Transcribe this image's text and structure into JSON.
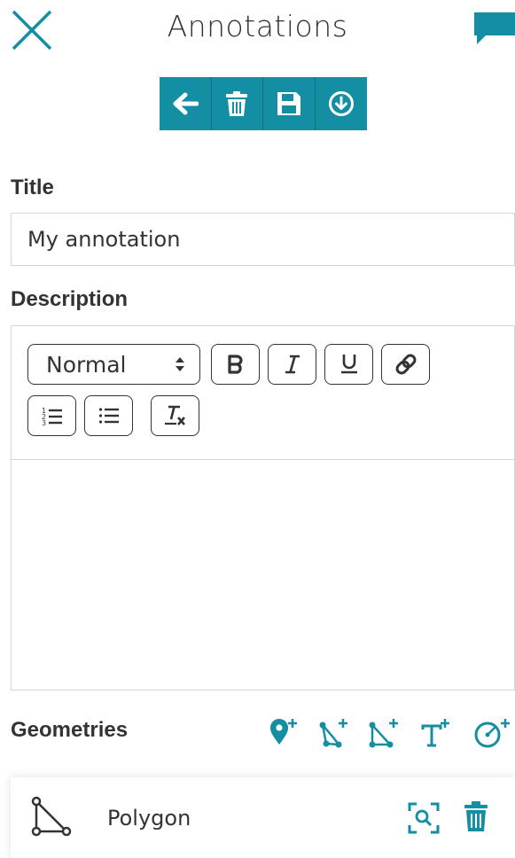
{
  "header": {
    "title": "Annotations"
  },
  "toolbar": {
    "buttons": [
      "back-arrow-icon",
      "trash-icon",
      "save-icon",
      "download-icon"
    ],
    "accent": "#138ea3"
  },
  "form": {
    "title_label": "Title",
    "title_value": "My annotation",
    "description_label": "Description",
    "format_select": "Normal"
  },
  "geometries": {
    "label": "Geometries",
    "tools": [
      "add-marker-icon",
      "add-line-icon",
      "add-polygon-icon",
      "add-text-icon",
      "add-circle-icon"
    ],
    "items": [
      {
        "name": "Polygon",
        "icon": "polygon-icon"
      }
    ]
  }
}
